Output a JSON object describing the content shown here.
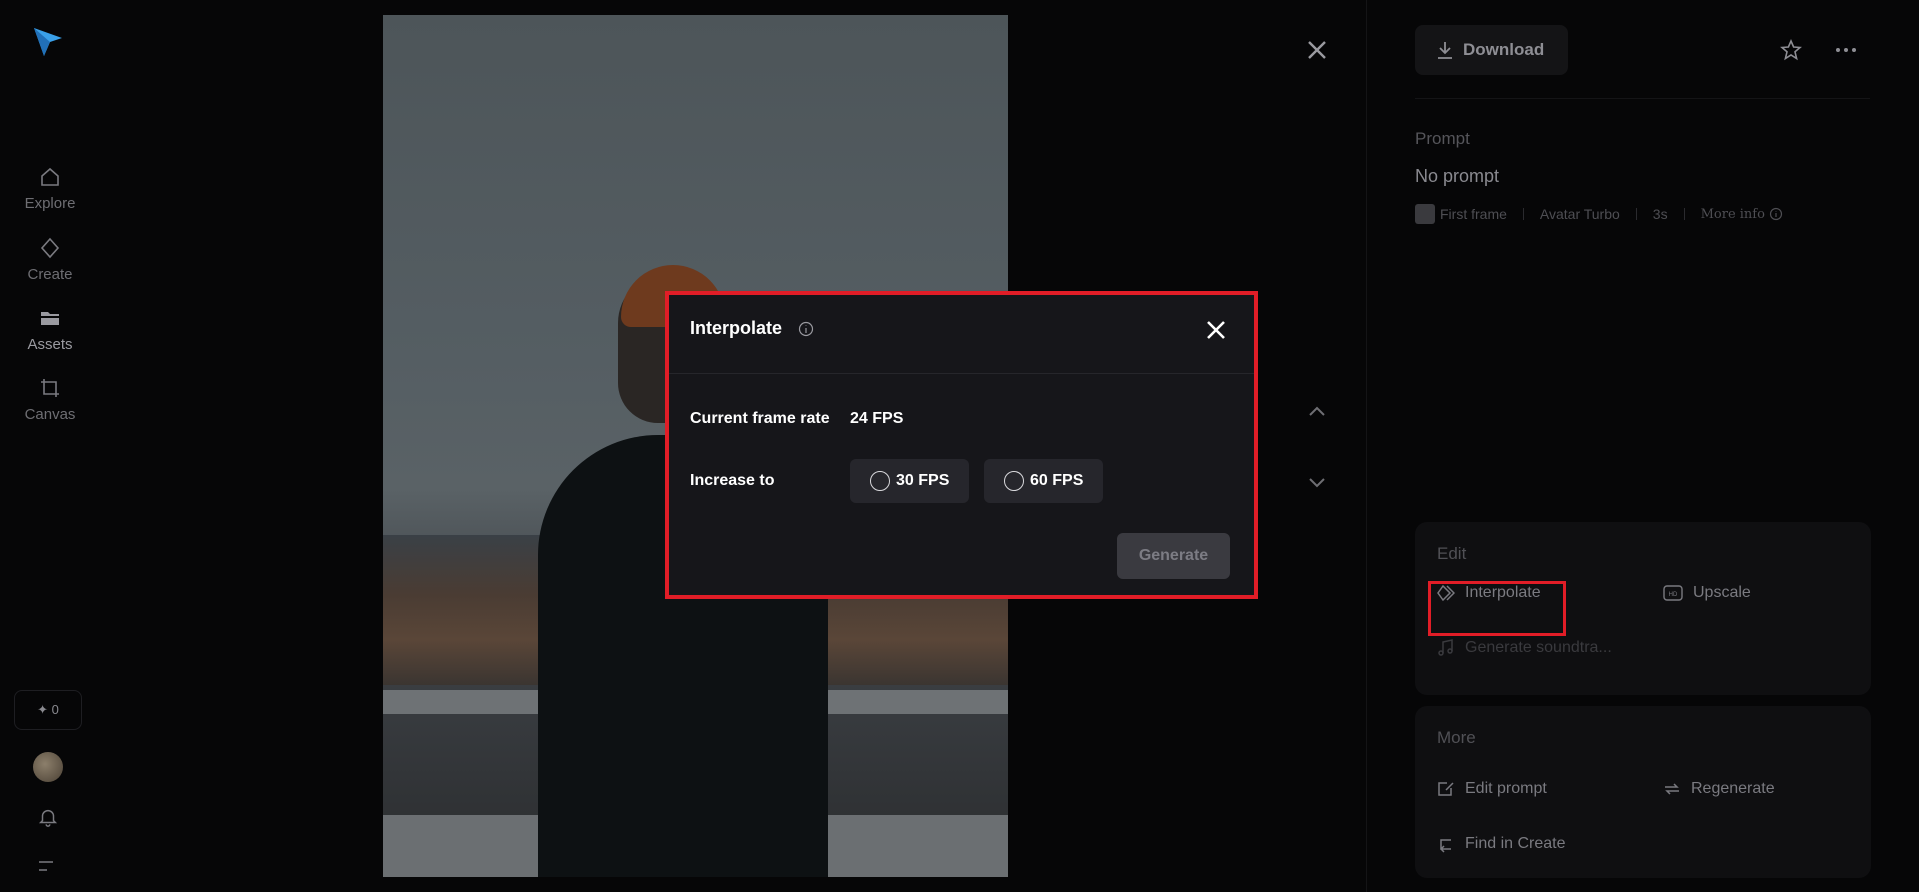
{
  "nav": {
    "items": [
      {
        "label": "Explore",
        "icon": "home-icon"
      },
      {
        "label": "Create",
        "icon": "diamond-icon"
      },
      {
        "label": "Assets",
        "icon": "folder-icon"
      },
      {
        "label": "Canvas",
        "icon": "crop-icon"
      }
    ],
    "credits": "✦ 0"
  },
  "viewer": {
    "close_icon": "close-icon",
    "prev_icon": "chevron-up-icon",
    "next_icon": "chevron-down-icon"
  },
  "panel": {
    "download_label": "Download",
    "prompt_label": "Prompt",
    "prompt_text": "No prompt",
    "meta": {
      "first_frame": "First frame",
      "model": "Avatar Turbo",
      "duration": "3s",
      "more_info": "More info"
    },
    "edit": {
      "title": "Edit",
      "interpolate": "Interpolate",
      "upscale": "Upscale",
      "generate_soundtrack": "Generate soundtra..."
    },
    "more": {
      "title": "More",
      "edit_prompt": "Edit prompt",
      "regenerate": "Regenerate",
      "find_in_create": "Find in Create"
    }
  },
  "modal": {
    "title": "Interpolate",
    "current_label": "Current frame rate",
    "current_value": "24 FPS",
    "increase_label": "Increase to",
    "options": [
      "30 FPS",
      "60 FPS"
    ],
    "generate_label": "Generate"
  },
  "colors": {
    "highlight": "#e11d27",
    "background": "#060607",
    "modal_bg": "#16161a"
  }
}
